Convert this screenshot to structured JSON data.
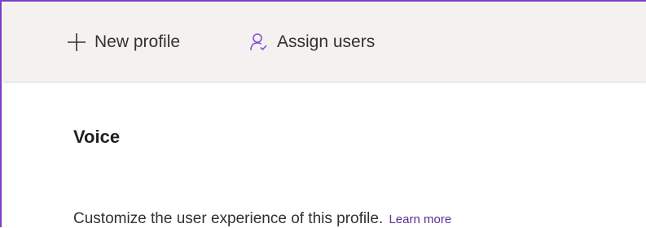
{
  "toolbar": {
    "new_profile": {
      "label": "New profile",
      "icon": "plus-icon"
    },
    "assign_users": {
      "label": "Assign users",
      "icon": "person-icon"
    }
  },
  "section": {
    "title": "Voice",
    "description": "Customize the user experience of this profile.",
    "learn_more": "Learn more"
  },
  "colors": {
    "accent_border": "#7b3fc4",
    "link": "#5c2e91",
    "icon_plus": "#323130",
    "icon_person": "#8a4fd1",
    "toolbar_bg": "#f3f2f1"
  }
}
